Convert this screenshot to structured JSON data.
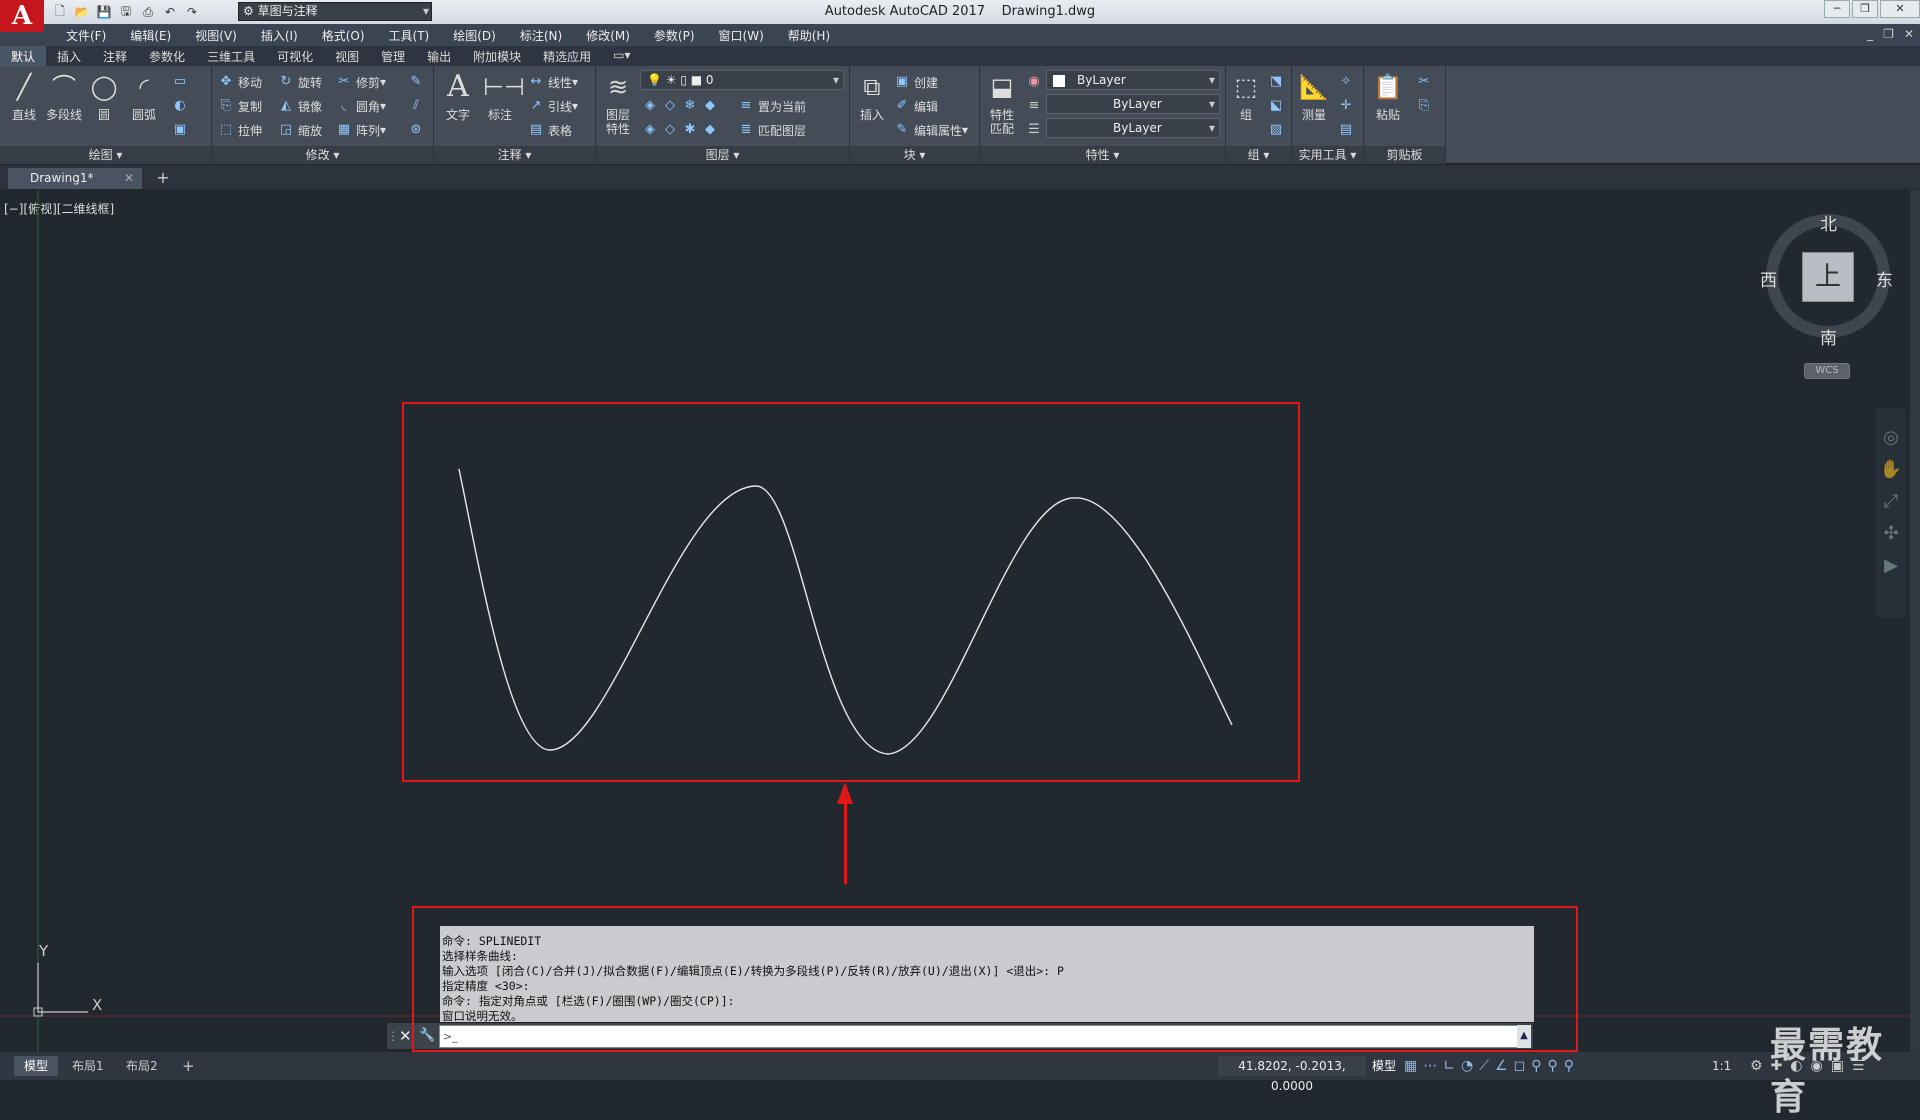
{
  "app": {
    "title": "Autodesk AutoCAD 2017",
    "file": "Drawing1.dwg",
    "logo": "A"
  },
  "quick_access": {
    "workspace": "草图与注释",
    "icons": [
      "new-icon",
      "open-icon",
      "save-icon",
      "saveas-icon",
      "print-icon",
      "undo-icon",
      "redo-icon"
    ]
  },
  "window_controls": {
    "minimize": "─",
    "restore": "❐",
    "close": "✕"
  },
  "menubar": {
    "items": [
      "文件(F)",
      "编辑(E)",
      "视图(V)",
      "插入(I)",
      "格式(O)",
      "工具(T)",
      "绘图(D)",
      "标注(N)",
      "修改(M)",
      "参数(P)",
      "窗口(W)",
      "帮助(H)"
    ],
    "right": [
      "_",
      "❐",
      "✕"
    ]
  },
  "ribbon_tabs": [
    "默认",
    "插入",
    "注释",
    "参数化",
    "三维工具",
    "可视化",
    "视图",
    "管理",
    "输出",
    "附加模块",
    "精选应用"
  ],
  "ribbon": {
    "draw": {
      "title": "绘图 ▾",
      "line": "直线",
      "pline": "多段线",
      "circle": "圆",
      "arc": "圆弧"
    },
    "modify": {
      "title": "修改 ▾",
      "move": "移动",
      "rotate": "旋转",
      "trim": "修剪",
      "copy": "复制",
      "mirror": "镜像",
      "fillet": "圆角",
      "stretch": "拉伸",
      "scale": "缩放",
      "array": "阵列"
    },
    "annotation": {
      "title": "注释 ▾",
      "text": "文字",
      "dim": "标注",
      "linear": "线性",
      "leader": "引线",
      "table": "表格"
    },
    "layers": {
      "title": "图层 ▾",
      "props": "图层\n特性",
      "current_layer": "0",
      "set_current": "置为当前",
      "match": "匹配图层"
    },
    "block": {
      "title": "块 ▾",
      "insert": "插入",
      "create": "创建",
      "edit": "编辑",
      "edit_attr": "编辑属性"
    },
    "properties": {
      "title": "特性 ▾",
      "match": "特性\n匹配",
      "color": "ByLayer",
      "linetype": "ByLayer",
      "lineweight": "ByLayer"
    },
    "groups": {
      "title": "组 ▾",
      "group": "组"
    },
    "utilities": {
      "title": "实用工具 ▾",
      "measure": "测量"
    },
    "clipboard": {
      "title": "剪贴板",
      "paste": "粘贴"
    }
  },
  "doc_tab": {
    "name": "Drawing1*",
    "close": "✕",
    "new": "+"
  },
  "viewport": {
    "label": "[−][俯视][二维线框]"
  },
  "viewcube": {
    "north": "北",
    "south": "南",
    "east": "东",
    "west": "西",
    "face": "上",
    "wcs": "WCS"
  },
  "ucs": {
    "x": "X",
    "y": "Y"
  },
  "command_history": [
    "命令: SPLINEDIT",
    "选择样条曲线:",
    "输入选项 [闭合(C)/合并(J)/拟合数据(F)/编辑顶点(E)/转换为多段线(P)/反转(R)/放弃(U)/退出(X)] <退出>: P",
    "指定精度 <30>:",
    "命令: 指定对角点或 [栏选(F)/圈围(WP)/圈交(CP)]:",
    "窗口说明无效。"
  ],
  "command_line": {
    "placeholder": "",
    "prompt": ">_"
  },
  "layout_tabs": [
    "模型",
    "布局1",
    "布局2"
  ],
  "status": {
    "coords": "41.8202, -0.2013, 0.0000",
    "model": "模型",
    "scale": "1:1"
  },
  "watermark": "最需教育",
  "colors": {
    "annotation_red": "#e01818",
    "canvas": "#212830",
    "curve": "#e8e8e8"
  }
}
